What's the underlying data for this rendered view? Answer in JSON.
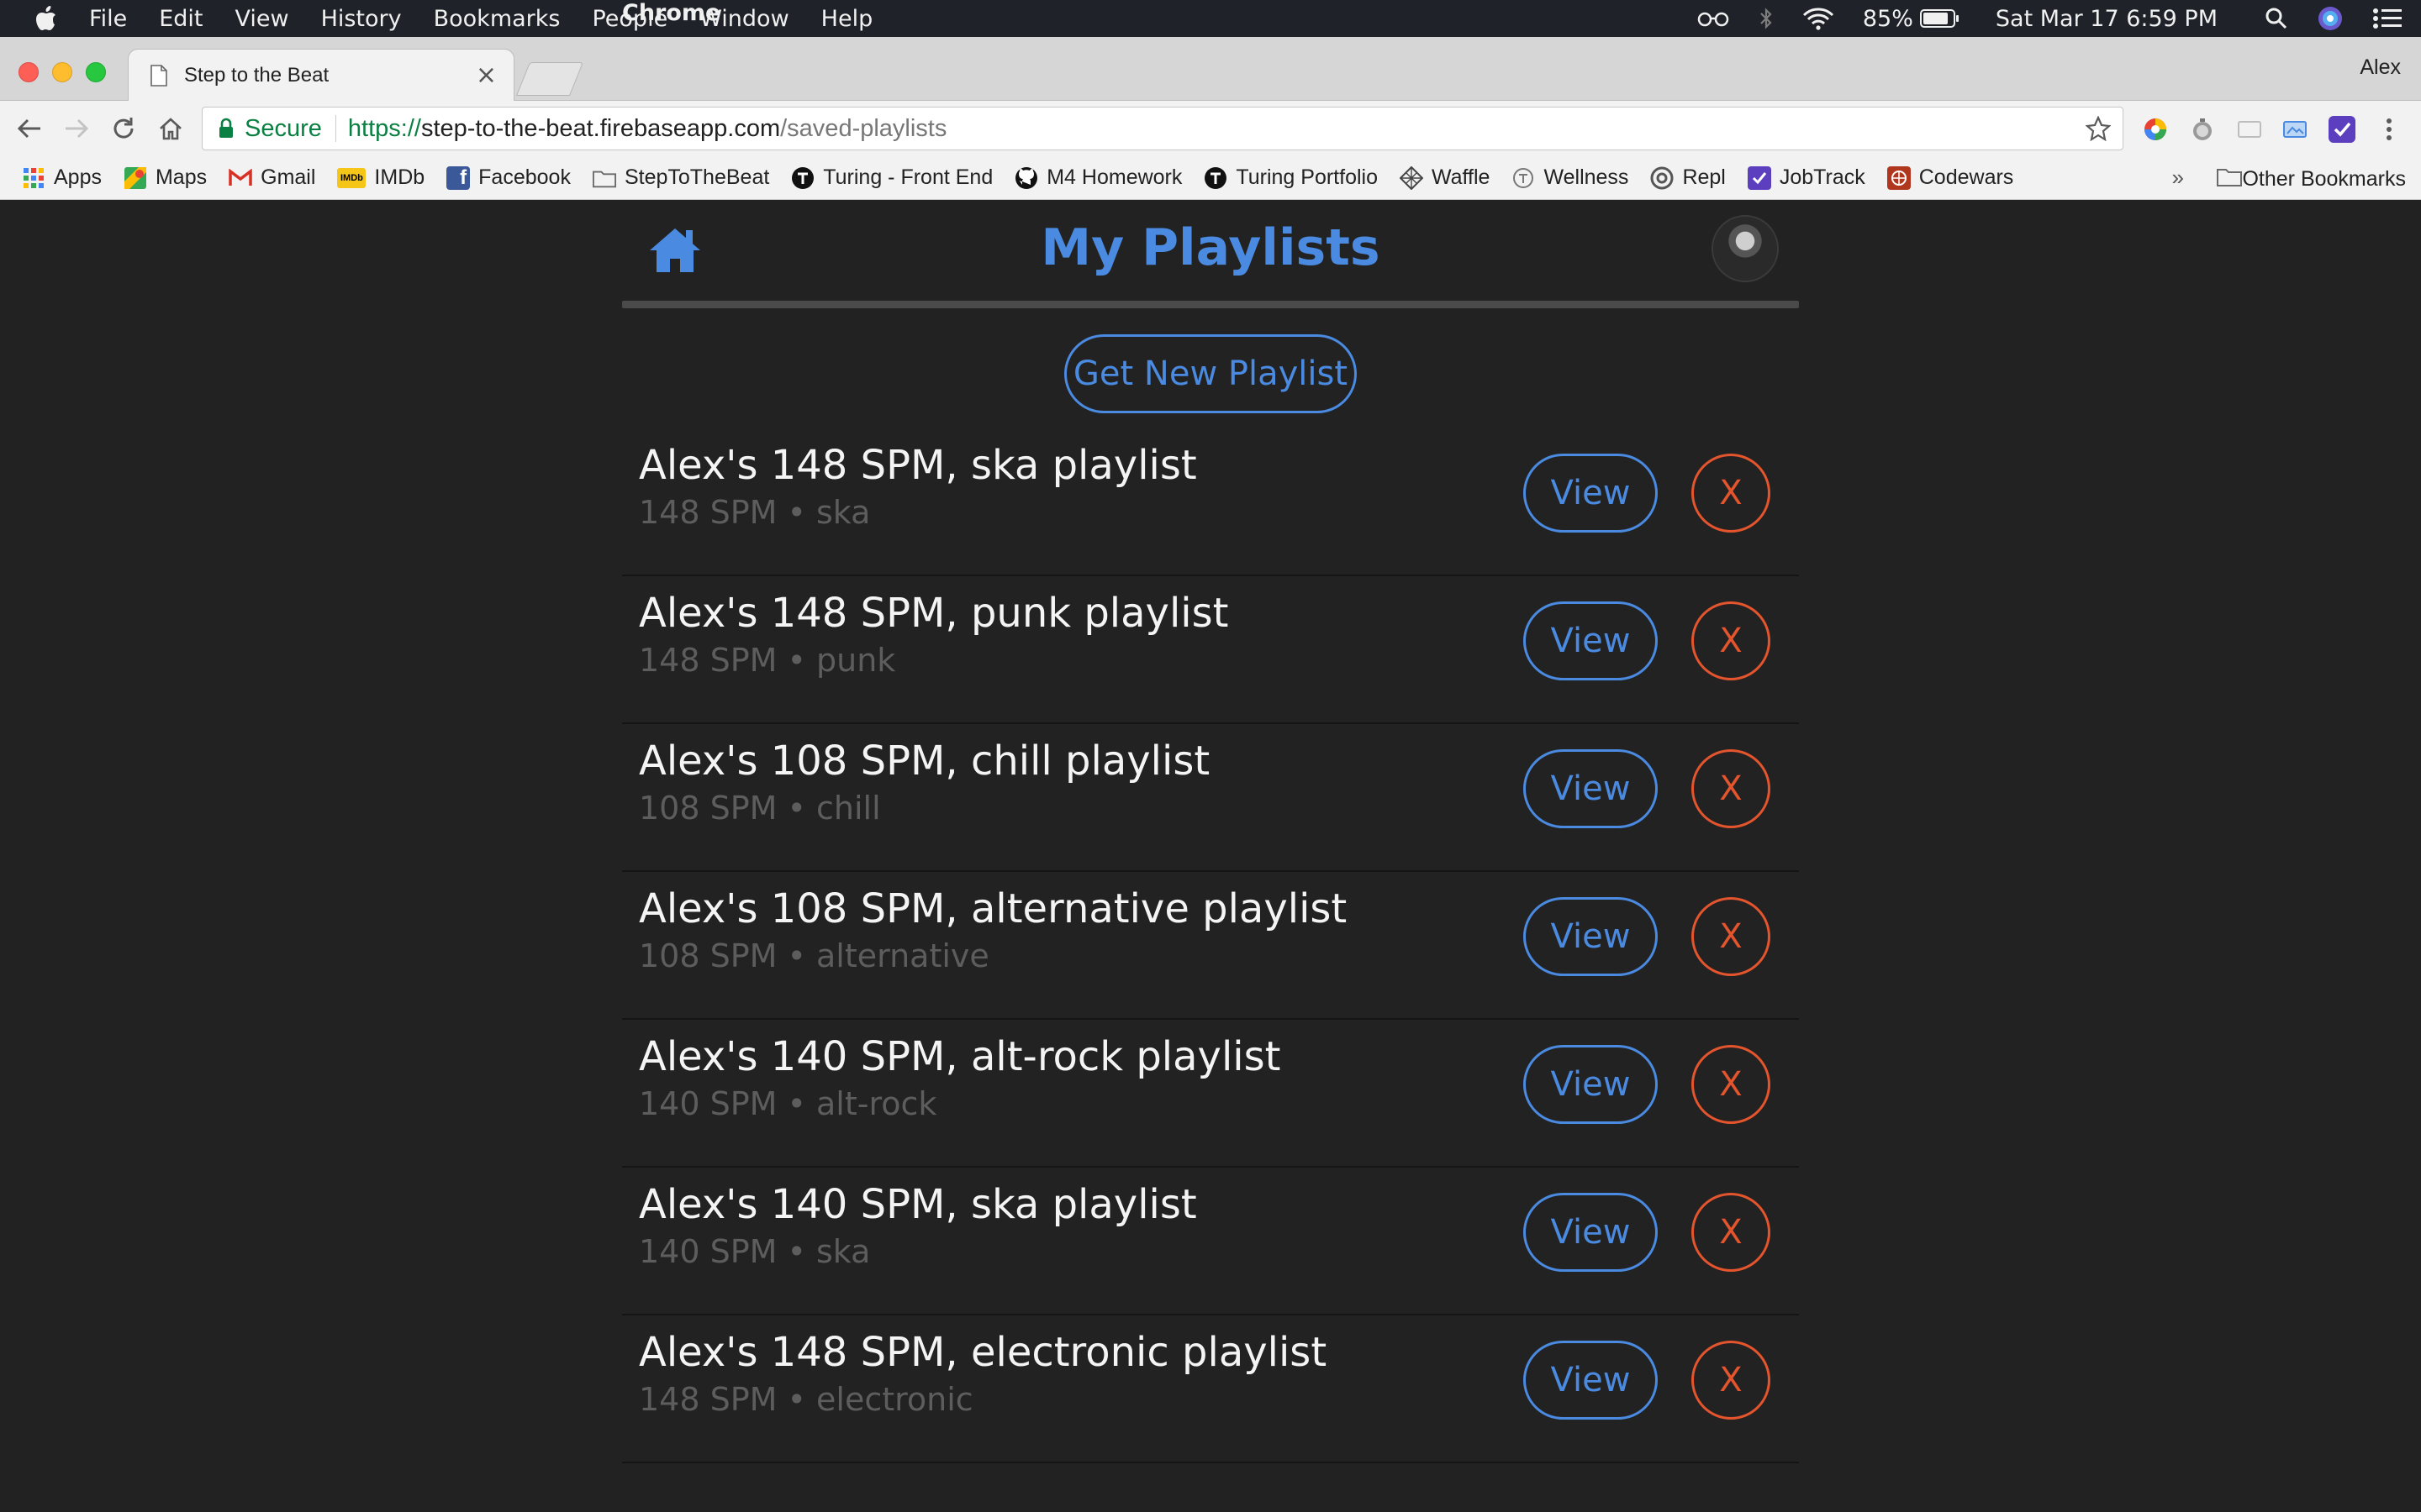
{
  "menubar": {
    "app_name": "Chrome",
    "menus": [
      "File",
      "Edit",
      "View",
      "History",
      "Bookmarks",
      "People",
      "Window",
      "Help"
    ],
    "battery": "85%",
    "datetime": "Sat Mar 17  6:59 PM"
  },
  "browser": {
    "tab_title": "Step to the Beat",
    "tab_close": "×",
    "profile_name": "Alex",
    "secure_label": "Secure",
    "url_scheme": "https://",
    "url_host": "step-to-the-beat.firebaseapp.com",
    "url_path": "/saved-playlists"
  },
  "bookmarks": {
    "items": [
      {
        "label": "Apps",
        "icon": "apps-grid-icon"
      },
      {
        "label": "Maps",
        "icon": "maps-icon"
      },
      {
        "label": "Gmail",
        "icon": "gmail-icon"
      },
      {
        "label": "IMDb",
        "icon": "imdb-icon"
      },
      {
        "label": "Facebook",
        "icon": "facebook-icon"
      },
      {
        "label": "StepToTheBeat",
        "icon": "folder-icon"
      },
      {
        "label": "Turing - Front End",
        "icon": "turing-icon"
      },
      {
        "label": "M4 Homework",
        "icon": "github-icon"
      },
      {
        "label": "Turing Portfolio",
        "icon": "turing-icon"
      },
      {
        "label": "Waffle",
        "icon": "waffle-icon"
      },
      {
        "label": "Wellness",
        "icon": "wellness-icon"
      },
      {
        "label": "Repl",
        "icon": "repl-icon"
      },
      {
        "label": "JobTrack",
        "icon": "jobtrack-icon"
      },
      {
        "label": "Codewars",
        "icon": "codewars-icon"
      }
    ],
    "overflow": "»",
    "other": "Other Bookmarks"
  },
  "app": {
    "title": "My Playlists",
    "new_playlist_label": "Get New Playlist",
    "view_label": "View",
    "delete_label": "X",
    "colors": {
      "accent": "#4a8ae0",
      "danger": "#e4552d",
      "background": "#222222"
    }
  },
  "playlists": [
    {
      "title": "Alex's 148 SPM, ska playlist",
      "subtitle": "148 SPM • ska"
    },
    {
      "title": "Alex's 148 SPM, punk playlist",
      "subtitle": "148 SPM • punk"
    },
    {
      "title": "Alex's 108 SPM, chill playlist",
      "subtitle": "108 SPM • chill"
    },
    {
      "title": "Alex's 108 SPM, alternative playlist",
      "subtitle": "108 SPM • alternative"
    },
    {
      "title": "Alex's 140 SPM, alt-rock playlist",
      "subtitle": "140 SPM • alt-rock"
    },
    {
      "title": "Alex's 140 SPM, ska playlist",
      "subtitle": "140 SPM • ska"
    },
    {
      "title": "Alex's 148 SPM, electronic playlist",
      "subtitle": "148 SPM • electronic"
    }
  ]
}
